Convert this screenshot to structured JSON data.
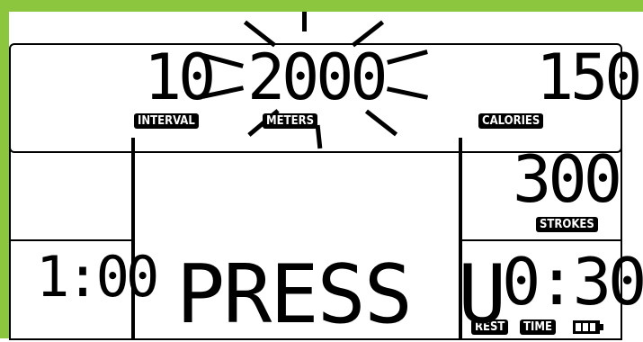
{
  "top": {
    "interval_value": "10",
    "interval_label": "INTERVAL",
    "meters_value": "2000",
    "meters_label": "METERS",
    "calories_value": "150",
    "calories_label": "CALORIES"
  },
  "right": {
    "strokes_value": "300",
    "strokes_label": "STROKES",
    "time_value": "0:30",
    "rest_label": "REST",
    "time_label": "TIME"
  },
  "left": {
    "time_value": "1:00"
  },
  "main": {
    "message": "PRESS U"
  },
  "colors": {
    "bezel": "#8cc63f",
    "segment": "#000000",
    "background": "#ffffff"
  },
  "icons": {
    "battery": "battery-icon",
    "flash": "flash-rays-icon"
  }
}
